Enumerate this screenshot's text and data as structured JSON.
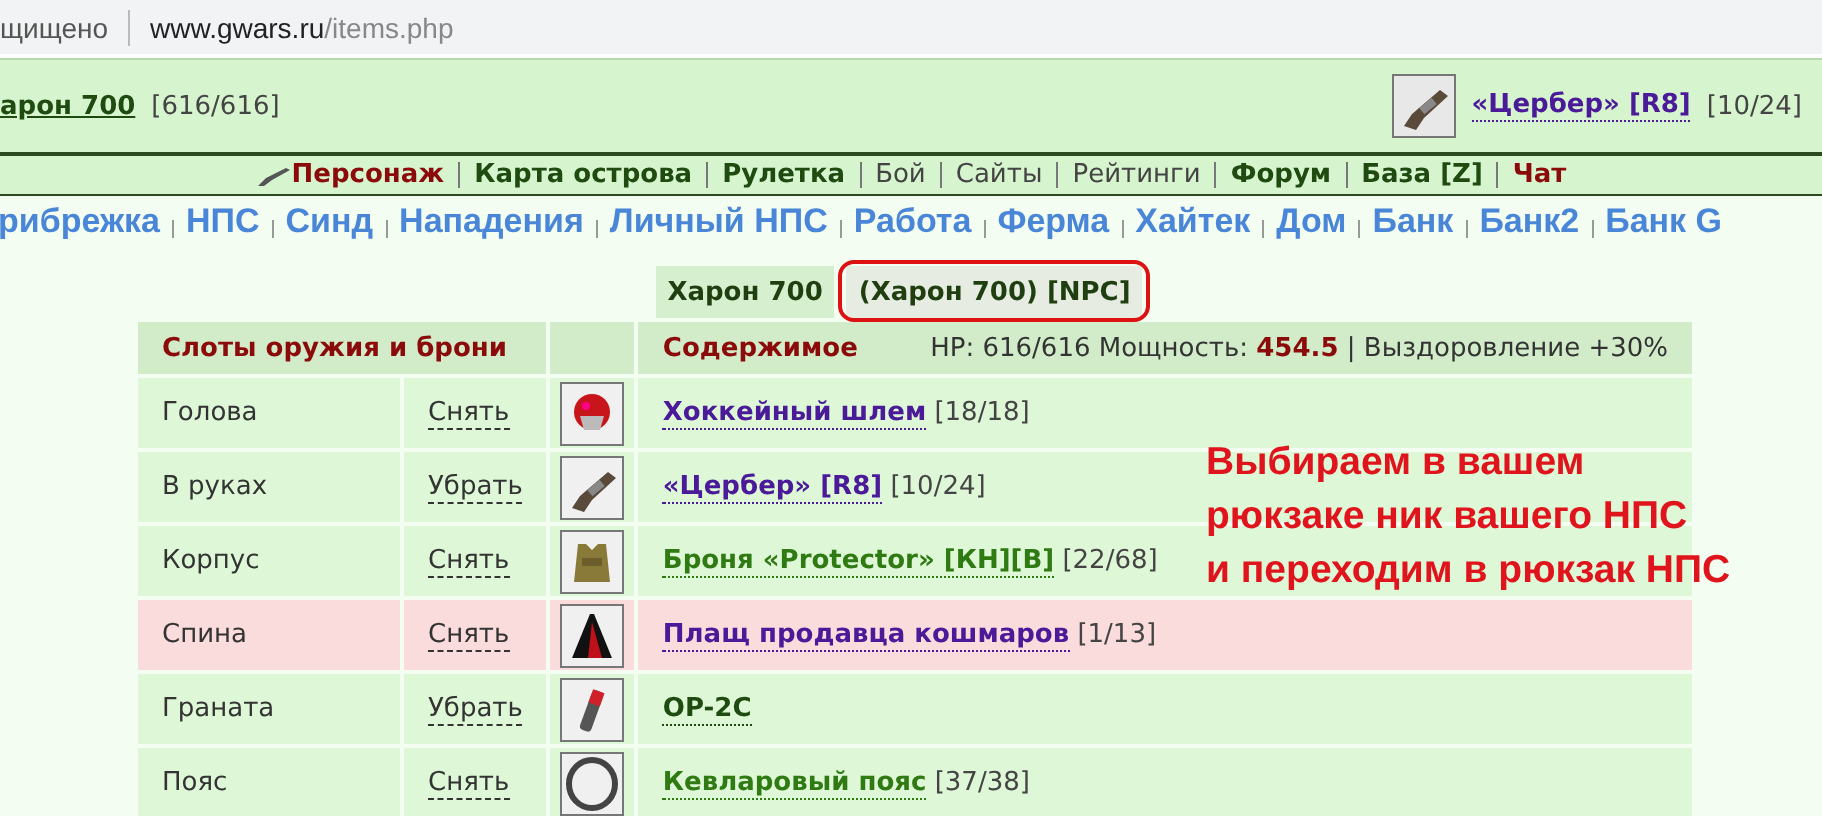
{
  "address_bar": {
    "security": "щищено",
    "url_host": "www.gwars.ru",
    "url_path": "/items.php"
  },
  "player": {
    "name": "арон 700",
    "hp": "[616/616]",
    "weapon": {
      "name": "«Цербер» [R8]",
      "ammo": "[10/24]"
    }
  },
  "main_menu": [
    {
      "label": "Персонаж",
      "kind": "current"
    },
    {
      "label": "Карта острова",
      "kind": "bold"
    },
    {
      "label": "Рулетка",
      "kind": "bold"
    },
    {
      "label": "Бой",
      "kind": "plain"
    },
    {
      "label": "Сайты",
      "kind": "plain"
    },
    {
      "label": "Рейтинги",
      "kind": "plain"
    },
    {
      "label": "Форум",
      "kind": "bold"
    },
    {
      "label": "База [Z]",
      "kind": "bold"
    },
    {
      "label": "Чат",
      "kind": "current"
    }
  ],
  "sub_menu": [
    "рибрежка",
    "НПС",
    "Синд",
    "Нападения",
    "Личный НПС",
    "Работа",
    "Ферма",
    "Хайтек",
    "Дом",
    "Банк",
    "Банк2",
    "Банк G"
  ],
  "tabs": [
    {
      "label": "Харон 700",
      "selected": true
    },
    {
      "label": "(Харон 700) [NPC]",
      "selected": false,
      "circled": true
    }
  ],
  "table": {
    "slots_header": "Слоты оружия и брони",
    "contents_header": "Содержимое",
    "hp": "HP: 616/616",
    "power_label": "Мощность:",
    "power": "454.5",
    "recovery": "| Выздоровление +30%",
    "rows": [
      {
        "slot": "Голова",
        "action": "Снять",
        "kind": "helmet",
        "item": "Хоккейный шлем",
        "color": "#4b1a99",
        "extra": "[18/18]",
        "highlighted": false
      },
      {
        "slot": "В руках",
        "action": "Убрать",
        "kind": "rifle",
        "item": "«Цербер» [R8]",
        "color": "#4b1a99",
        "extra": "[10/24]",
        "highlighted": false
      },
      {
        "slot": "Корпус",
        "action": "Снять",
        "kind": "vest",
        "item": "Броня «Protector» [КН][В]",
        "color": "#2f7a12",
        "extra": "[22/68]",
        "highlighted": false
      },
      {
        "slot": "Спина",
        "action": "Снять",
        "kind": "cloak",
        "item": "Плащ продавца кошмаров",
        "color": "#4b1a99",
        "extra": "[1/13]",
        "highlighted": true
      },
      {
        "slot": "Граната",
        "action": "Убрать",
        "kind": "grenade",
        "item": "OP-2C",
        "color": "#1f4a10",
        "highlighted": false
      },
      {
        "slot": "Пояс",
        "action": "Снять",
        "kind": "belt",
        "item": "Кевларовый пояс",
        "color": "#2f7a12",
        "extra": "[37/38]",
        "highlighted": false
      }
    ]
  },
  "annotation": {
    "lines": [
      "Выбираем в вашем",
      "рюкзаке ник вашего НПС",
      "и переходим в рюкзак НПС"
    ]
  }
}
